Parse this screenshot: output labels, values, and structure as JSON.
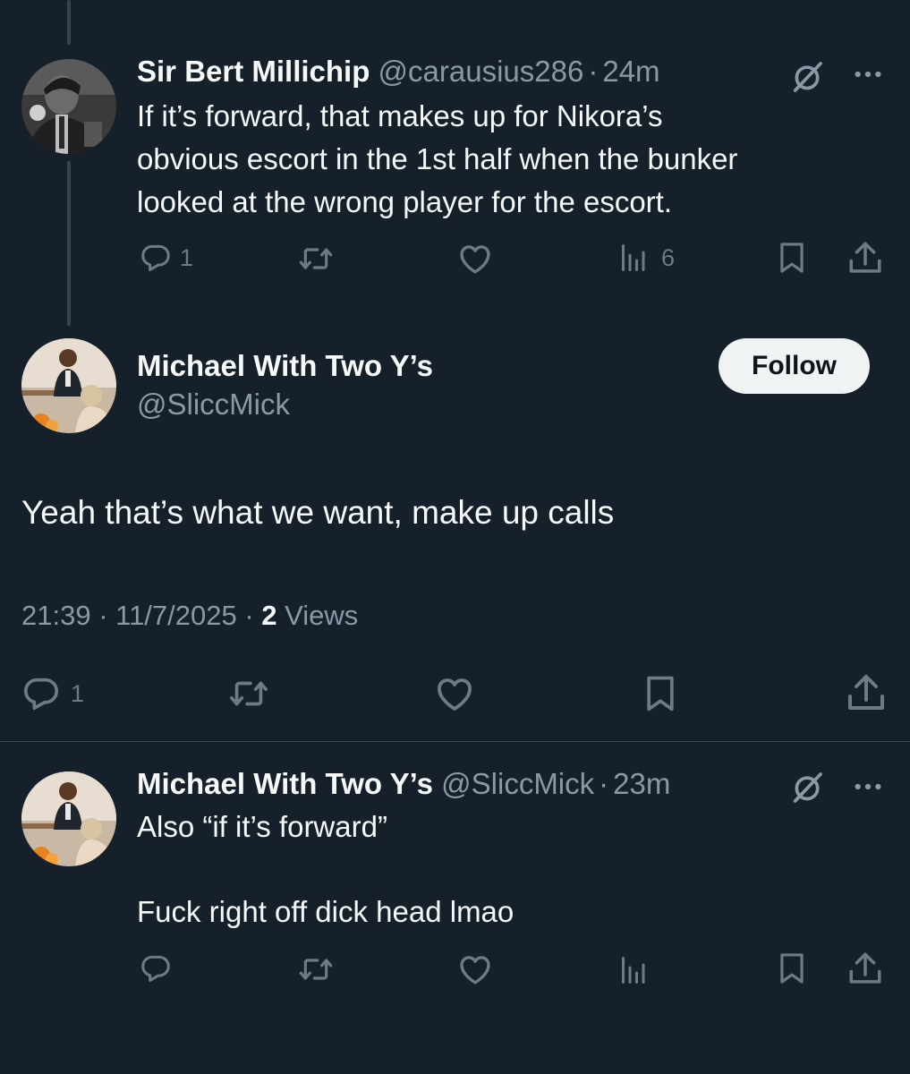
{
  "tweet1": {
    "display_name": "Sir Bert Millichip",
    "handle": "@carausius286",
    "sep": "·",
    "time": "24m",
    "lines": [
      "If it’s forward, that makes up for Nikora’s",
      "obvious escort in the 1st half when the bunker",
      "looked at the wrong player for the escort."
    ],
    "reply_count": "1",
    "view_count": "6"
  },
  "main": {
    "display_name": "Michael With Two Y’s",
    "handle": "@SliccMick",
    "follow_label": "Follow",
    "text": "Yeah that’s what we want, make up calls",
    "meta_time": "21:39 · 11/7/2025 · ",
    "views_count": "2",
    "views_label": " Views",
    "reply_count": "1"
  },
  "tweet3": {
    "display_name": "Michael With Two Y’s",
    "handle": "@SliccMick",
    "sep": "·",
    "time": "23m",
    "line1": "Also “if it’s forward”",
    "line2": "Fuck right off dick head lmao"
  },
  "colors": {
    "background": "#15202b",
    "text": "#f7f9f9",
    "muted": "#8b98a5",
    "icon": "#6e7b87",
    "divider": "#38444d",
    "button_bg": "#eff3f4"
  },
  "icons": [
    "reply-icon",
    "repost-icon",
    "like-icon",
    "views-icon",
    "bookmark-icon",
    "share-icon",
    "grok-icon",
    "more-icon"
  ]
}
